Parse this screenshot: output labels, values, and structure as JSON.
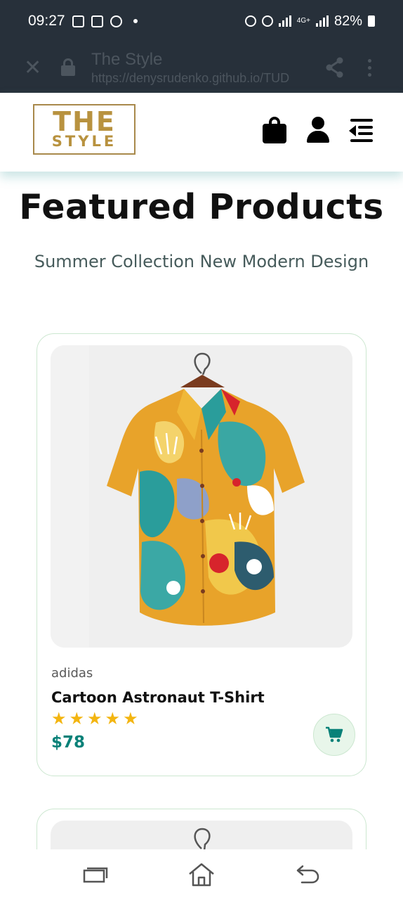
{
  "status_bar": {
    "time": "09:27",
    "network": "4G+",
    "battery": "82%"
  },
  "browser": {
    "page_title": "The Style",
    "url": "https://denysrudenko.github.io/TUD"
  },
  "header": {
    "logo_line1": "THE",
    "logo_line2": "STYLE"
  },
  "section": {
    "title": "Featured Products",
    "subtitle": "Summer Collection New Modern Design"
  },
  "products": [
    {
      "brand": "adidas",
      "name": "Cartoon Astronaut T-Shirt",
      "rating": 5,
      "stars": "★★★★★",
      "price": "$78"
    }
  ],
  "colors": {
    "accent": "#088178",
    "star": "#f3b510",
    "logo_gold": "#b8923f",
    "status_bar_bg": "#27303a"
  },
  "icons": {
    "cart": "cart-icon",
    "bag": "shopping-bag-icon",
    "user": "user-icon",
    "menu": "menu-icon"
  }
}
